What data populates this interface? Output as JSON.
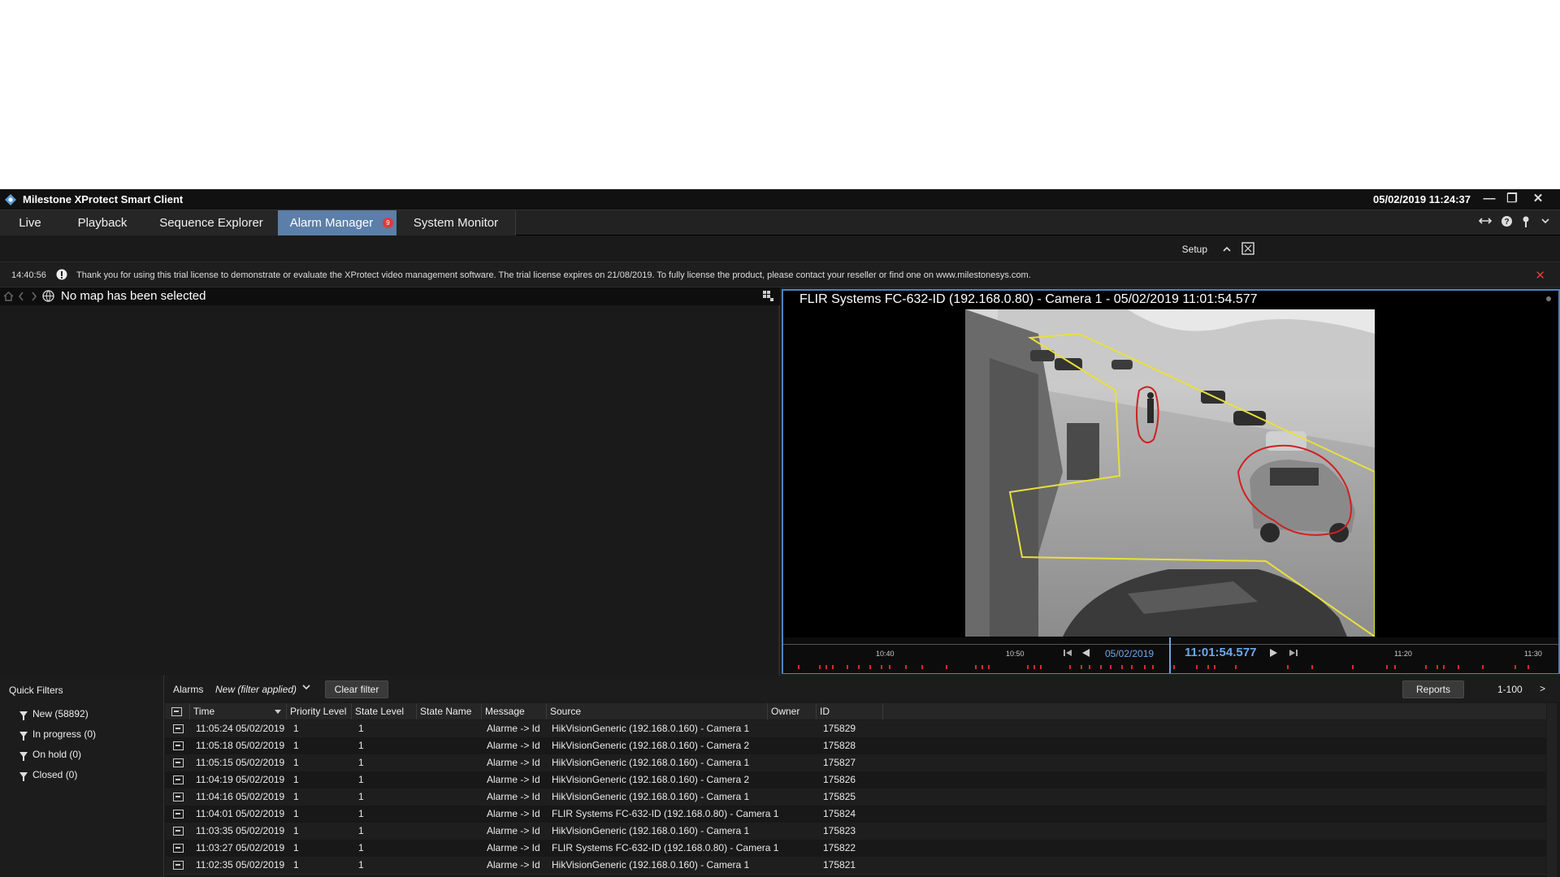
{
  "window": {
    "title": "Milestone XProtect Smart Client",
    "datetime": "05/02/2019 11:24:37",
    "minimize_label": "—",
    "restore_label": "❐",
    "close_label": "✕"
  },
  "tabs": [
    {
      "label": "Live"
    },
    {
      "label": "Playback"
    },
    {
      "label": "Sequence Explorer"
    },
    {
      "label": "Alarm Manager",
      "active": true,
      "badge": "9"
    },
    {
      "label": "System Monitor"
    }
  ],
  "toolbar": {
    "setup_label": "Setup"
  },
  "notice": {
    "time": "14:40:56",
    "text": "Thank you for using this trial license to demonstrate or evaluate the XProtect video management software. The trial license expires on 21/08/2019. To fully license the product, please contact your reseller or find one on www.milestonesys.com."
  },
  "map": {
    "empty_text": "No map has been selected"
  },
  "camera": {
    "title": "FLIR Systems FC-632-ID (192.168.0.80) - Camera 1 - 05/02/2019 11:01:54.577"
  },
  "timeline": {
    "labels": [
      "10:40",
      "10:50",
      "11:20",
      "11:30"
    ],
    "date": "05/02/2019",
    "time": "11:01:54.577"
  },
  "quick_filters": {
    "title": "Quick Filters",
    "items": [
      {
        "label": "New (58892)"
      },
      {
        "label": "In progress (0)"
      },
      {
        "label": "On hold (0)"
      },
      {
        "label": "Closed (0)"
      }
    ]
  },
  "alarms_bar": {
    "label": "Alarms",
    "filter": "New (filter applied)",
    "clear_filter": "Clear filter",
    "reports": "Reports",
    "range": "1-100",
    "next": ">"
  },
  "table": {
    "columns": [
      "Time",
      "Priority Level",
      "State Level",
      "State Name",
      "Message",
      "Source",
      "Owner",
      "ID"
    ],
    "rows": [
      [
        "11:05:24 05/02/2019",
        "1",
        "1",
        "",
        "Alarme -> Id",
        "HikVisionGeneric (192.168.0.160) - Camera 1",
        "",
        "175829"
      ],
      [
        "11:05:18 05/02/2019",
        "1",
        "1",
        "",
        "Alarme -> Id",
        "HikVisionGeneric (192.168.0.160) - Camera 2",
        "",
        "175828"
      ],
      [
        "11:05:15 05/02/2019",
        "1",
        "1",
        "",
        "Alarme -> Id",
        "HikVisionGeneric (192.168.0.160) - Camera 1",
        "",
        "175827"
      ],
      [
        "11:04:19 05/02/2019",
        "1",
        "1",
        "",
        "Alarme -> Id",
        "HikVisionGeneric (192.168.0.160) - Camera 2",
        "",
        "175826"
      ],
      [
        "11:04:16 05/02/2019",
        "1",
        "1",
        "",
        "Alarme -> Id",
        "HikVisionGeneric (192.168.0.160) - Camera 1",
        "",
        "175825"
      ],
      [
        "11:04:01 05/02/2019",
        "1",
        "1",
        "",
        "Alarme -> Id",
        "FLIR Systems FC-632-ID (192.168.0.80) - Camera 1",
        "",
        "175824"
      ],
      [
        "11:03:35 05/02/2019",
        "1",
        "1",
        "",
        "Alarme -> Id",
        "HikVisionGeneric (192.168.0.160) - Camera 1",
        "",
        "175823"
      ],
      [
        "11:03:27 05/02/2019",
        "1",
        "1",
        "",
        "Alarme -> Id",
        "FLIR Systems FC-632-ID (192.168.0.80) - Camera 1",
        "",
        "175822"
      ],
      [
        "11:02:35 05/02/2019",
        "1",
        "1",
        "",
        "Alarme -> Id",
        "HikVisionGeneric (192.168.0.160) - Camera 1",
        "",
        "175821"
      ]
    ]
  },
  "colors": {
    "accent": "#5b7fa8",
    "camera_border": "#4a82c0",
    "alert_red": "#e03a3a",
    "timeline_blue": "#6ea8e8",
    "zone_yellow": "#e8e03a",
    "detection_red": "#d02020"
  }
}
